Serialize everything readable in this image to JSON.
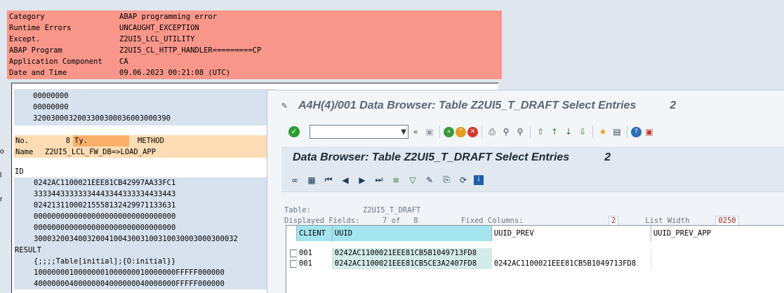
{
  "edge_letters": [
    "o",
    "l",
    "r"
  ],
  "error_header": [
    {
      "key": "Category",
      "value": "ABAP programming error"
    },
    {
      "key": "Runtime Errors",
      "value": "UNCAUGHT_EXCEPTION"
    },
    {
      "key": "Except.",
      "value": "Z2UI5_LCL_UTILITY"
    },
    {
      "key": "ABAP Program",
      "value": "Z2UI5_CL_HTTP_HANDLER=========CP"
    },
    {
      "key": "Application Component",
      "value": "CA"
    },
    {
      "key": "Date and Time",
      "value": "09.06.2023 00:21:08 (UTC)"
    }
  ],
  "hex_block": [
    "00000000",
    "00000000",
    "3200300032003300300036003000390"
  ],
  "stack": {
    "no_label": "No.",
    "no_value": "8",
    "ty_label": "Ty.",
    "ty_value": "METHOD",
    "name_label": "Name",
    "name_value": "Z2UI5_LCL_FW_DB=>LOAD_APP"
  },
  "variables": {
    "id_label": "ID",
    "id_values": [
      "0242AC1100021EEE81CB42997AA33FC1",
      "33334433333334443344333334433443",
      "02421311000215558132429971133631",
      "00000000000000000000000000000000",
      "00000000000000000000000000000000",
      "3000320034003200410043003100310030003000300032"
    ],
    "result_label": "RESULT",
    "result_values": [
      "{;;;;Table[initial];{O:initial}}",
      "10000000100000001000000010000000FFFFF000000",
      "40000000400000004000000040000000FFFFF000000"
    ]
  },
  "window": {
    "title": "A4H(4)/001 Data Browser: Table Z2UI5_T_DRAFT Select Entries",
    "title_count": "2",
    "command_field": ""
  },
  "content": {
    "title": "Data Browser: Table Z2UI5_T_DRAFT Select Entries",
    "count": "2",
    "table_label": "Table:",
    "table_value": "Z2UI5_T_DRAFT",
    "displayed_label": "Displayed Fields:",
    "displayed_value": "7 of   8",
    "fixed_label": "Fixed Columns:",
    "fixed_value": "2",
    "width_label": "List Width",
    "width_value": "0250"
  },
  "grid": {
    "headers": [
      "CLIENT",
      "UUID",
      "UUID_PREV",
      "UUID_PREV_APP"
    ],
    "rows": [
      {
        "client": "001",
        "uuid": "0242AC1100021EEE81CB5B1049713FD8",
        "uuid_prev": "",
        "uuid_prev_app": ""
      },
      {
        "client": "001",
        "uuid": "0242AC1100021EEE81CB5CE3A2407FD8",
        "uuid_prev": "0242AC1100021EEE81CB5B1049713FD8",
        "uuid_prev_app": ""
      }
    ]
  },
  "colors": {
    "error_bg": "#f8968a",
    "stack_bg": "#fcdcb4",
    "header_cyan": "#a3e4ee"
  }
}
